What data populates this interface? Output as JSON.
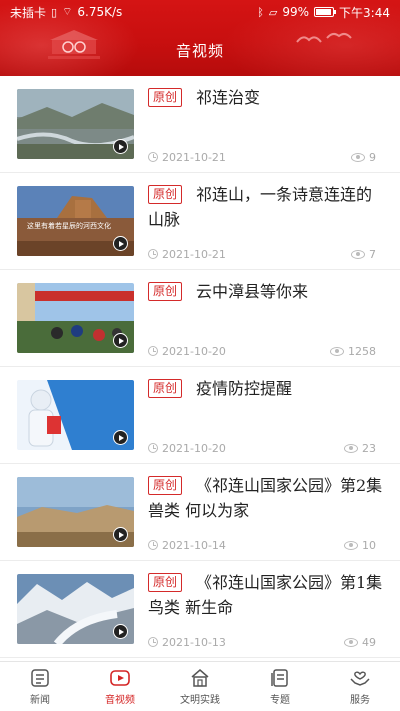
{
  "status_bar": {
    "carrier": "未插卡",
    "speed": "6.75K/s",
    "battery": "99%",
    "time": "下午3:44"
  },
  "header": {
    "title": "音视频"
  },
  "colors": {
    "brand_red": "#cc1414",
    "badge_red": "#d42a2a",
    "active_tab": "#d42424"
  },
  "items": [
    {
      "badge": "原创",
      "title": "祁连治变",
      "date": "2021-10-21",
      "views": "9",
      "thumb_caption": ""
    },
    {
      "badge": "原创",
      "title": "祁连山，一条诗意连连的山脉",
      "date": "2021-10-21",
      "views": "7",
      "thumb_caption": "这里有着若星辰的河西文化"
    },
    {
      "badge": "原创",
      "title": "云中漳县等你来",
      "date": "2021-10-20",
      "views": "1258",
      "thumb_caption": ""
    },
    {
      "badge": "原创",
      "title": "疫情防控提醒",
      "date": "2021-10-20",
      "views": "23",
      "thumb_caption": ""
    },
    {
      "badge": "原创",
      "title": "《祁连山国家公园》第2集 兽类 何以为家",
      "date": "2021-10-14",
      "views": "10",
      "thumb_caption": ""
    },
    {
      "badge": "原创",
      "title": "《祁连山国家公园》第1集 鸟类 新生命",
      "date": "2021-10-13",
      "views": "49",
      "thumb_caption": ""
    }
  ],
  "tabs": [
    {
      "label": "新闻",
      "icon": "news-icon",
      "active": false
    },
    {
      "label": "音视频",
      "icon": "video-play-icon",
      "active": true
    },
    {
      "label": "文明实践",
      "icon": "house-icon",
      "active": false
    },
    {
      "label": "专题",
      "icon": "topic-icon",
      "active": false
    },
    {
      "label": "服务",
      "icon": "service-hands-icon",
      "active": false
    }
  ]
}
